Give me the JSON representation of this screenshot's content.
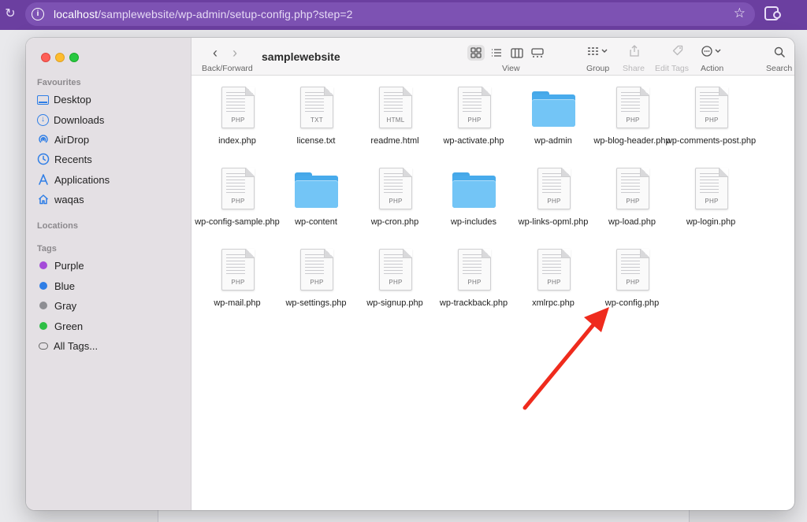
{
  "browser": {
    "url_host": "localhost",
    "url_path": "/samplewebsite/wp-admin/setup-config.php?step=2",
    "icons": [
      "reload-icon",
      "info-icon",
      "star-icon",
      "extensions-icon"
    ]
  },
  "finder": {
    "title": "samplewebsite",
    "toolbar": {
      "back_forward_label": "Back/Forward",
      "view_label": "View",
      "group_label": "Group",
      "share_label": "Share",
      "edit_tags_label": "Edit Tags",
      "action_label": "Action",
      "search_label": "Search"
    },
    "sidebar": {
      "favourites_title": "Favourites",
      "favourites": [
        {
          "label": "Desktop",
          "icon": "desktop-icon"
        },
        {
          "label": "Downloads",
          "icon": "downloads-icon"
        },
        {
          "label": "AirDrop",
          "icon": "airdrop-icon"
        },
        {
          "label": "Recents",
          "icon": "recents-icon"
        },
        {
          "label": "Applications",
          "icon": "applications-icon"
        },
        {
          "label": "waqas",
          "icon": "home-icon"
        }
      ],
      "locations_title": "Locations",
      "tags_title": "Tags",
      "tags": [
        {
          "label": "Purple",
          "color": "#a54cd9"
        },
        {
          "label": "Blue",
          "color": "#2f7ee6"
        },
        {
          "label": "Gray",
          "color": "#8e8e93"
        },
        {
          "label": "Green",
          "color": "#2dbf45"
        }
      ],
      "all_tags_label": "All Tags..."
    },
    "files": [
      {
        "name": "index.php",
        "kind": "doc",
        "ext": "PHP"
      },
      {
        "name": "license.txt",
        "kind": "doc",
        "ext": "TXT"
      },
      {
        "name": "readme.html",
        "kind": "doc",
        "ext": "HTML"
      },
      {
        "name": "wp-activate.php",
        "kind": "doc",
        "ext": "PHP"
      },
      {
        "name": "wp-admin",
        "kind": "folder",
        "ext": ""
      },
      {
        "name": "wp-blog-header.php",
        "kind": "doc",
        "ext": "PHP"
      },
      {
        "name": "wp-comments-post.php",
        "kind": "doc",
        "ext": "PHP"
      },
      {
        "name": "wp-config-sample.php",
        "kind": "doc",
        "ext": "PHP"
      },
      {
        "name": "wp-content",
        "kind": "folder",
        "ext": ""
      },
      {
        "name": "wp-cron.php",
        "kind": "doc",
        "ext": "PHP"
      },
      {
        "name": "wp-includes",
        "kind": "folder",
        "ext": ""
      },
      {
        "name": "wp-links-opml.php",
        "kind": "doc",
        "ext": "PHP"
      },
      {
        "name": "wp-load.php",
        "kind": "doc",
        "ext": "PHP"
      },
      {
        "name": "wp-login.php",
        "kind": "doc",
        "ext": "PHP"
      },
      {
        "name": "wp-mail.php",
        "kind": "doc",
        "ext": "PHP"
      },
      {
        "name": "wp-settings.php",
        "kind": "doc",
        "ext": "PHP"
      },
      {
        "name": "wp-signup.php",
        "kind": "doc",
        "ext": "PHP"
      },
      {
        "name": "wp-trackback.php",
        "kind": "doc",
        "ext": "PHP"
      },
      {
        "name": "xmlrpc.php",
        "kind": "doc",
        "ext": "PHP"
      },
      {
        "name": "wp-config.php",
        "kind": "doc",
        "ext": "PHP"
      }
    ],
    "annotation": {
      "color": "#ef2b1d",
      "points_to": "wp-config.php"
    }
  }
}
